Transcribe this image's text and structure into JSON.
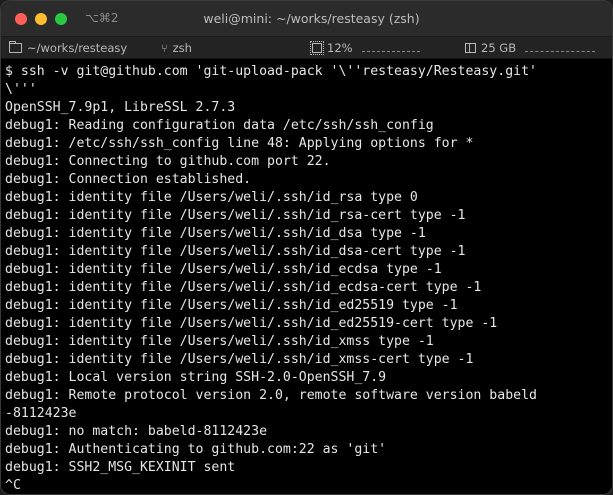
{
  "window": {
    "title": "weli@mini: ~/works/resteasy (zsh)",
    "shortcut": "⌥⌘2"
  },
  "statusbar": {
    "path": "~/works/resteasy",
    "shell": "zsh",
    "cpu": "12%",
    "disk": "25 GB"
  },
  "colors": {
    "close": "#ff5f57",
    "minimize": "#febc2e",
    "maximize": "#28c840",
    "terminal_bg": "#000000",
    "terminal_fg": "#e6e6e6"
  },
  "terminal": {
    "lines": [
      "$ ssh -v git@github.com 'git-upload-pack '\\''resteasy/Resteasy.git'",
      "\\'''",
      "OpenSSH_7.9p1, LibreSSL 2.7.3",
      "debug1: Reading configuration data /etc/ssh/ssh_config",
      "debug1: /etc/ssh/ssh_config line 48: Applying options for *",
      "debug1: Connecting to github.com port 22.",
      "debug1: Connection established.",
      "debug1: identity file /Users/weli/.ssh/id_rsa type 0",
      "debug1: identity file /Users/weli/.ssh/id_rsa-cert type -1",
      "debug1: identity file /Users/weli/.ssh/id_dsa type -1",
      "debug1: identity file /Users/weli/.ssh/id_dsa-cert type -1",
      "debug1: identity file /Users/weli/.ssh/id_ecdsa type -1",
      "debug1: identity file /Users/weli/.ssh/id_ecdsa-cert type -1",
      "debug1: identity file /Users/weli/.ssh/id_ed25519 type -1",
      "debug1: identity file /Users/weli/.ssh/id_ed25519-cert type -1",
      "debug1: identity file /Users/weli/.ssh/id_xmss type -1",
      "debug1: identity file /Users/weli/.ssh/id_xmss-cert type -1",
      "debug1: Local version string SSH-2.0-OpenSSH_7.9",
      "debug1: Remote protocol version 2.0, remote software version babeld",
      "-8112423e",
      "debug1: no match: babeld-8112423e",
      "debug1: Authenticating to github.com:22 as 'git'",
      "debug1: SSH2_MSG_KEXINIT sent",
      "^C"
    ]
  }
}
